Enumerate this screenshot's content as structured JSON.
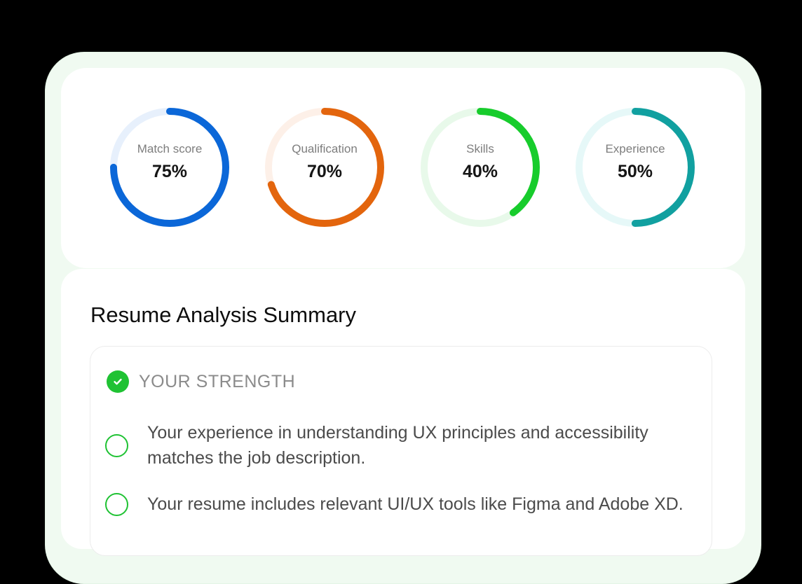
{
  "gauges": [
    {
      "label": "Match score",
      "value": "75%",
      "fraction": 0.75,
      "color": "#0b67d8",
      "track": "#e7f0fc"
    },
    {
      "label": "Qualification",
      "value": "70%",
      "fraction": 0.7,
      "color": "#e3650d",
      "track": "#fdf0e8"
    },
    {
      "label": "Skills",
      "value": "40%",
      "fraction": 0.4,
      "color": "#17cc2c",
      "track": "#e8f9ea"
    },
    {
      "label": "Experience",
      "value": "50%",
      "fraction": 0.5,
      "color": "#11a0a0",
      "track": "#e6f8f8"
    }
  ],
  "summary": {
    "title": "Resume Analysis Summary",
    "strength_title": "YOUR STRENGTH",
    "items": [
      "Your experience in understanding UX principles and accessibility matches the job description.",
      "Your resume includes relevant UI/UX tools like Figma and Adobe XD."
    ]
  },
  "icons": {
    "strength": "check-circle-icon",
    "item": "empty-circle-icon"
  }
}
